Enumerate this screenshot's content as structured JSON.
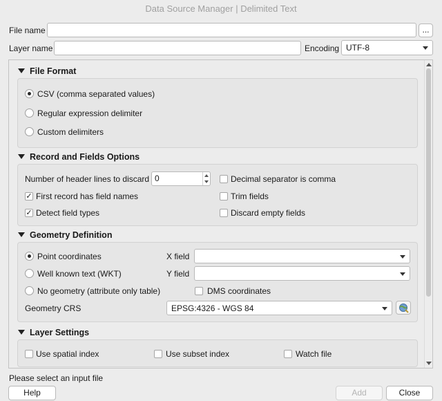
{
  "window": {
    "title": "Data Source Manager | Delimited Text"
  },
  "file": {
    "label": "File name",
    "value": "",
    "browse_label": "..."
  },
  "layer": {
    "label": "Layer name",
    "value": ""
  },
  "encoding": {
    "label": "Encoding",
    "value": "UTF-8"
  },
  "file_format": {
    "header": "File Format",
    "options": [
      {
        "label": "CSV (comma separated values)",
        "selected": true
      },
      {
        "label": "Regular expression delimiter",
        "selected": false
      },
      {
        "label": "Custom delimiters",
        "selected": false
      }
    ]
  },
  "record_options": {
    "header": "Record and Fields Options",
    "header_lines_label": "Number of header lines to discard",
    "header_lines_value": "0",
    "first_record": {
      "label": "First record has field names",
      "checked": true,
      "mark": "✓"
    },
    "detect_types": {
      "label": "Detect field types",
      "checked": true,
      "mark": "✓"
    },
    "decimal_comma": {
      "label": "Decimal separator is comma",
      "checked": false
    },
    "trim_fields": {
      "label": "Trim fields",
      "checked": false
    },
    "discard_empty": {
      "label": "Discard empty fields",
      "checked": false
    }
  },
  "geometry": {
    "header": "Geometry Definition",
    "options": [
      {
        "label": "Point coordinates",
        "selected": true
      },
      {
        "label": "Well known text (WKT)",
        "selected": false
      },
      {
        "label": "No geometry (attribute only table)",
        "selected": false
      }
    ],
    "x_field_label": "X field",
    "x_field_value": "",
    "y_field_label": "Y field",
    "y_field_value": "",
    "dms_label": "DMS coordinates",
    "crs_label": "Geometry CRS",
    "crs_value": "EPSG:4326 - WGS 84"
  },
  "layer_settings": {
    "header": "Layer Settings",
    "spatial_index": "Use spatial index",
    "subset_index": "Use subset index",
    "watch_file": "Watch file"
  },
  "status": {
    "message": "Please select an input file"
  },
  "buttons": {
    "help": "Help",
    "add": "Add",
    "close": "Close"
  }
}
